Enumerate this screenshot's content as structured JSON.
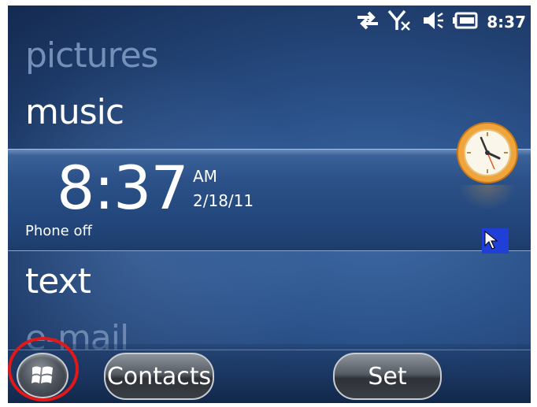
{
  "status_bar": {
    "icons": [
      "data-sync-icon",
      "signal-off-icon",
      "speaker-icon",
      "battery-icon"
    ],
    "time": "8:37"
  },
  "menu": {
    "pictures": "pictures",
    "music": "music",
    "text": "text",
    "email": "e-mail"
  },
  "clock": {
    "time": "8:37",
    "ampm": "AM",
    "date": "2/18/11",
    "phone_status": "Phone off",
    "icon": "analog-clock-icon"
  },
  "softkeys": {
    "start_icon": "windows-logo-icon",
    "left_label": "Contacts",
    "right_label": "Set"
  },
  "colors": {
    "background": "#2a5088",
    "highlight_ring": "#e01818",
    "clock_accent": "#f0a43c"
  }
}
